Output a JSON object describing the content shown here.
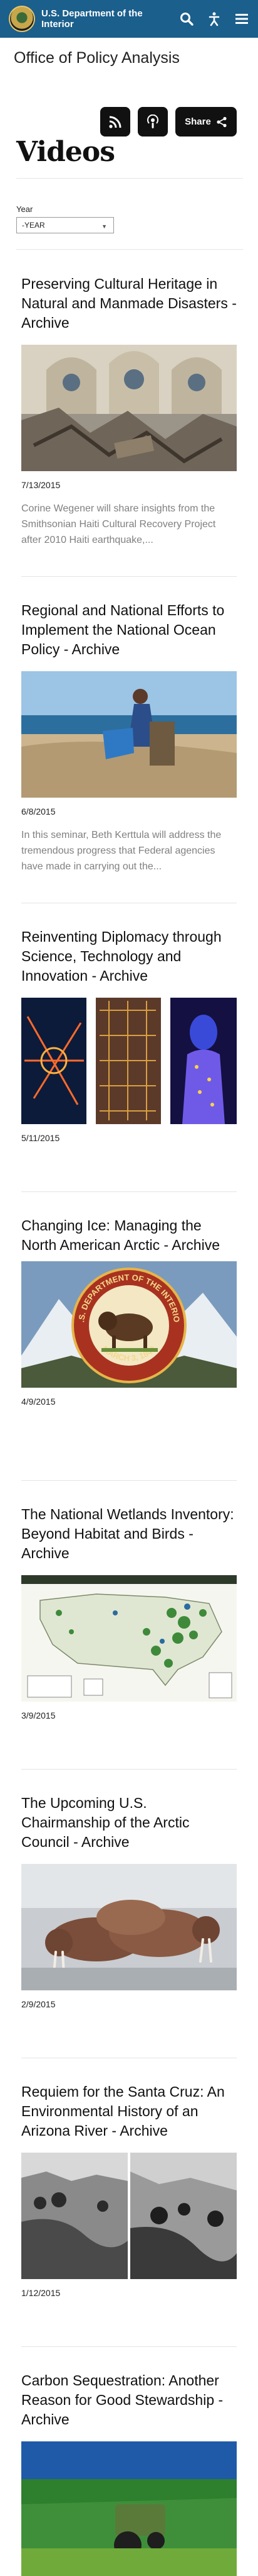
{
  "header": {
    "agency_name": "U.S. Department of the Interior",
    "search_icon": "search-icon",
    "accessibility_icon": "accessibility-icon",
    "menu_icon": "hamburger-menu-icon",
    "bar_color": "#1b5f8c"
  },
  "office_title": "Office of Policy Analysis",
  "actions": {
    "rss_icon": "rss-icon",
    "podcast_icon": "podcast-icon",
    "share_label": "Share",
    "share_icon": "share-icon"
  },
  "page_title": "Videos",
  "filter": {
    "label": "Year",
    "selected": "-YEAR"
  },
  "videos": [
    {
      "title": "Preserving Cultural Heritage in Natural and Manmade Disasters - Archive",
      "date": "7/13/2015",
      "description": "Corine Wegener will share insights from the Smithsonian Haiti Cultural Recovery Project after 2010 Haiti earthquake,..."
    },
    {
      "title": "Regional and National Efforts to Implement the National Ocean Policy - Archive",
      "date": "6/8/2015",
      "description": "In this seminar, Beth Kerttula will address the tremendous progress that Federal agencies have made in carrying out the..."
    },
    {
      "title": "Reinventing Diplomacy through Science, Technology and Innovation - Archive",
      "date": "5/11/2015"
    },
    {
      "title": "Changing Ice: Managing the North American Arctic - Archive",
      "date": "4/9/2015",
      "seal_top": "U.S. DEPARTMENT OF THE INTERIOR",
      "seal_bottom": "MARCH 3, 1849"
    },
    {
      "title": "The National Wetlands Inventory: Beyond Habitat and Birds - Archive",
      "date": "3/9/2015"
    },
    {
      "title": "The Upcoming U.S. Chairmanship of the Arctic Council - Archive",
      "date": "2/9/2015"
    },
    {
      "title": "Requiem for the Santa Cruz: An Environmental History of an Arizona River - Archive",
      "date": "1/12/2015"
    },
    {
      "title": "Carbon Sequestration: Another Reason for Good Stewardship - Archive"
    }
  ]
}
